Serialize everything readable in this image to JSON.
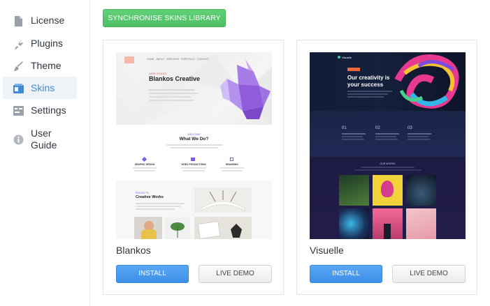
{
  "sidebar": {
    "items": [
      {
        "label": "License",
        "icon": "document-icon"
      },
      {
        "label": "Plugins",
        "icon": "plug-icon"
      },
      {
        "label": "Theme",
        "icon": "brush-icon"
      },
      {
        "label": "Skins",
        "icon": "skins-icon",
        "active": true
      },
      {
        "label": "Settings",
        "icon": "settings-icon"
      },
      {
        "label": "User Guide",
        "icon": "info-icon"
      }
    ]
  },
  "toolbar": {
    "sync_label": "SYNCHRONISE SKINS LIBRARY"
  },
  "skins": [
    {
      "name": "Blankos",
      "install_label": "INSTALL",
      "demo_label": "LIVE DEMO",
      "preview": {
        "hero_title": "Blankos Creative",
        "hero_kicker": "WEB STUDIO",
        "section_heading": "What We Do?",
        "section_kicker": "WELCOME",
        "services": [
          "GRAPHIC DESIGN",
          "VIDEO PRODUCTIONS",
          "BRANDING"
        ],
        "works_kicker": "PROJECTS",
        "works_title": "Creative Works"
      }
    },
    {
      "name": "Visuelle",
      "install_label": "INSTALL",
      "demo_label": "LIVE DEMO",
      "preview": {
        "brand": "Visuelle",
        "hero_title": "Our creativity is your success",
        "steps": [
          "01",
          "02",
          "03"
        ],
        "gallery_kicker": "OUR WORKS"
      }
    }
  ],
  "colors": {
    "sync_button": "#4dbf63",
    "install_button": "#3d8fe8",
    "active_nav": "#3f8ad6"
  }
}
